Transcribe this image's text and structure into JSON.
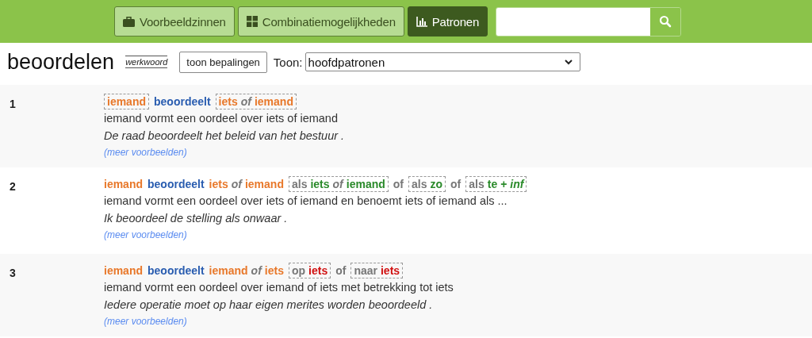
{
  "nav": {
    "tabs": [
      {
        "label": "Voorbeeldzinnen",
        "selected": false
      },
      {
        "label": "Combinatiemogelijkheden",
        "selected": false
      },
      {
        "label": "Patronen",
        "selected": true
      }
    ]
  },
  "header": {
    "word": "beoordelen",
    "word_class": "werkwoord",
    "toggle_button": "toon bepalingen",
    "show_label": "Toon:",
    "show_value": "hoofdpatronen"
  },
  "patterns": [
    {
      "number": "1",
      "pattern": [
        {
          "boxed": true,
          "parts": [
            {
              "text": "iemand",
              "color": "#e8782a",
              "italic": false
            }
          ]
        },
        {
          "boxed": false,
          "parts": [
            {
              "text": "beoordeelt",
              "color": "#2a5db0",
              "italic": false
            }
          ]
        },
        {
          "boxed": true,
          "parts": [
            {
              "text": "iets",
              "color": "#e8782a",
              "italic": false
            },
            {
              "text": "of",
              "color": "#777777",
              "italic": true
            },
            {
              "text": "iemand",
              "color": "#e8782a",
              "italic": false
            }
          ]
        }
      ],
      "definition": "iemand vormt een oordeel over iets of iemand",
      "example": "De raad beoordeelt het beleid van het bestuur .",
      "more": "(meer voorbeelden)"
    },
    {
      "number": "2",
      "pattern": [
        {
          "boxed": false,
          "parts": [
            {
              "text": "iemand",
              "color": "#e8782a",
              "italic": false
            }
          ]
        },
        {
          "boxed": false,
          "parts": [
            {
              "text": "beoordeelt",
              "color": "#2a5db0",
              "italic": false
            }
          ]
        },
        {
          "boxed": false,
          "parts": [
            {
              "text": "iets",
              "color": "#e8782a",
              "italic": false
            },
            {
              "text": "of",
              "color": "#777777",
              "italic": true
            },
            {
              "text": "iemand",
              "color": "#e8782a",
              "italic": false
            }
          ]
        },
        {
          "boxed": true,
          "parts": [
            {
              "text": "als",
              "color": "#777777",
              "italic": false
            },
            {
              "text": "iets",
              "color": "#2a8a2a",
              "italic": false
            },
            {
              "text": "of",
              "color": "#777777",
              "italic": true
            },
            {
              "text": "iemand",
              "color": "#2a8a2a",
              "italic": false
            }
          ]
        },
        {
          "boxed": false,
          "parts": [
            {
              "text": "of",
              "color": "#777777",
              "italic": false
            }
          ]
        },
        {
          "boxed": true,
          "parts": [
            {
              "text": "als",
              "color": "#777777",
              "italic": false
            },
            {
              "text": "zo",
              "color": "#2a8a2a",
              "italic": false
            }
          ]
        },
        {
          "boxed": false,
          "parts": [
            {
              "text": "of",
              "color": "#777777",
              "italic": false
            }
          ]
        },
        {
          "boxed": true,
          "parts": [
            {
              "text": "als",
              "color": "#777777",
              "italic": false
            },
            {
              "text": "te",
              "color": "#2a8a2a",
              "italic": false
            },
            {
              "text": "+",
              "color": "#2a8a2a",
              "italic": false
            },
            {
              "text": "inf",
              "color": "#2a8a2a",
              "italic": true
            }
          ]
        }
      ],
      "definition": "iemand vormt een oordeel over iets of iemand en benoemt iets of iemand als ...",
      "example": "Ik beoordeel de stelling als onwaar .",
      "more": "(meer voorbeelden)"
    },
    {
      "number": "3",
      "pattern": [
        {
          "boxed": false,
          "parts": [
            {
              "text": "iemand",
              "color": "#e8782a",
              "italic": false
            }
          ]
        },
        {
          "boxed": false,
          "parts": [
            {
              "text": "beoordeelt",
              "color": "#2a5db0",
              "italic": false
            }
          ]
        },
        {
          "boxed": false,
          "parts": [
            {
              "text": "iemand",
              "color": "#e8782a",
              "italic": false
            },
            {
              "text": "of",
              "color": "#777777",
              "italic": true
            },
            {
              "text": "iets",
              "color": "#e8782a",
              "italic": false
            }
          ]
        },
        {
          "boxed": true,
          "parts": [
            {
              "text": "op",
              "color": "#777777",
              "italic": false
            },
            {
              "text": "iets",
              "color": "#d01010",
              "italic": false
            }
          ]
        },
        {
          "boxed": false,
          "parts": [
            {
              "text": "of",
              "color": "#777777",
              "italic": false
            }
          ]
        },
        {
          "boxed": true,
          "parts": [
            {
              "text": "naar",
              "color": "#777777",
              "italic": false
            },
            {
              "text": "iets",
              "color": "#d01010",
              "italic": false
            }
          ]
        }
      ],
      "definition": "iemand vormt een oordeel over iemand of iets met betrekking tot iets",
      "example": "Iedere operatie moet op haar eigen merites worden beoordeeld .",
      "more": "(meer voorbeelden)"
    }
  ]
}
